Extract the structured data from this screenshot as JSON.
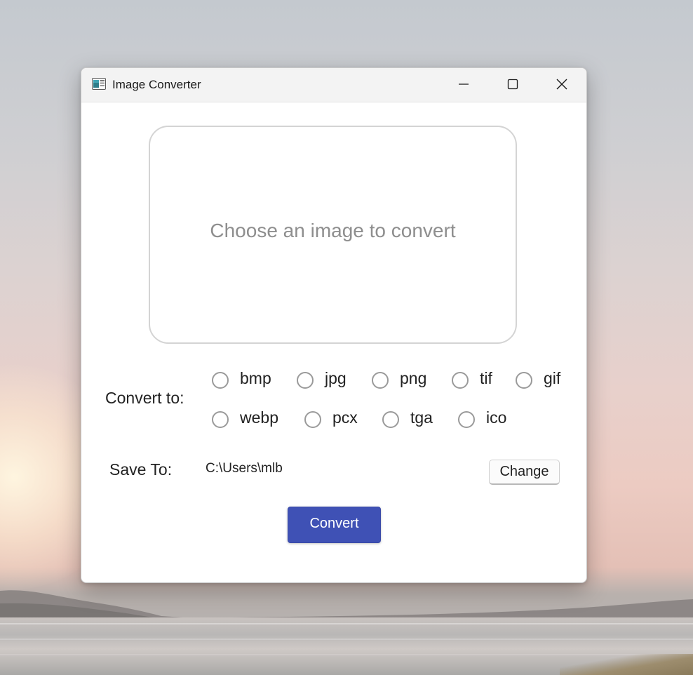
{
  "window": {
    "title": "Image Converter",
    "controls": {
      "minimize_icon": "minimize-icon",
      "maximize_icon": "maximize-icon",
      "close_icon": "close-icon"
    }
  },
  "dropzone": {
    "placeholder": "Choose an image to convert"
  },
  "convert_to": {
    "label": "Convert to:",
    "formats": [
      "bmp",
      "jpg",
      "png",
      "tif",
      "gif",
      "webp",
      "pcx",
      "tga",
      "ico"
    ],
    "selected": null
  },
  "save_to": {
    "label": "Save To:",
    "path": "C:\\Users\\mlb",
    "change_label": "Change"
  },
  "actions": {
    "convert_label": "Convert"
  },
  "colors": {
    "accent": "#3f51b5",
    "window_bg": "#ffffff",
    "titlebar_bg": "#f3f3f3"
  }
}
